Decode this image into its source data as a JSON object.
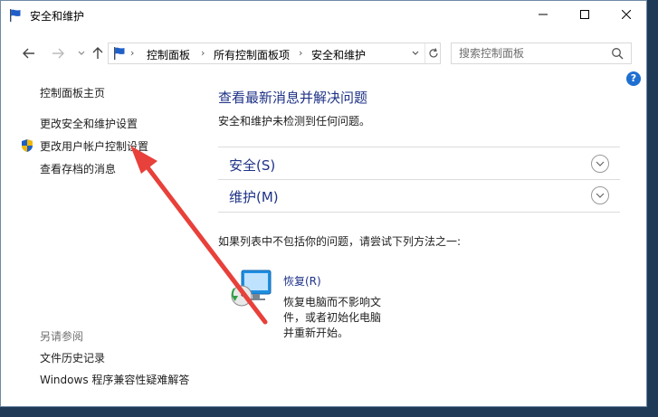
{
  "window": {
    "title": "安全和维护"
  },
  "address": {
    "breadcrumbs": [
      "控制面板",
      "所有控制面板项",
      "安全和维护"
    ]
  },
  "search": {
    "placeholder": "搜索控制面板"
  },
  "help": {
    "label": "?"
  },
  "sidebar": {
    "items": [
      {
        "label": "控制面板主页"
      },
      {
        "label": "更改安全和维护设置"
      },
      {
        "label": "更改用户帐户控制设置"
      },
      {
        "label": "查看存档的消息"
      }
    ],
    "see_also_title": "另请参阅",
    "see_also": [
      {
        "label": "文件历史记录"
      },
      {
        "label": "Windows 程序兼容性疑难解答"
      }
    ]
  },
  "main": {
    "title": "查看最新消息并解决问题",
    "subtitle": "安全和维护未检测到任何问题。",
    "sections": [
      {
        "label": "安全(S)"
      },
      {
        "label": "维护(M)"
      }
    ],
    "intro": "如果列表中不包括你的问题，请尝试下列方法之一:",
    "recovery": {
      "link": "恢复(R)",
      "desc": [
        "恢复电脑而不影响文",
        "件，或者初始化电脑",
        "并重新开始。"
      ]
    }
  },
  "colors": {
    "link": "#1e3287",
    "annotation_arrow": "#e8403a",
    "help_badge": "#1f6fd1"
  },
  "icons": [
    "flag-icon",
    "minimize-icon",
    "maximize-icon",
    "close-icon",
    "back-arrow-icon",
    "forward-arrow-icon",
    "recent-chevron-icon",
    "up-arrow-icon",
    "refresh-icon",
    "search-icon",
    "help-icon",
    "uac-shield-icon",
    "expand-chevron-icon",
    "recovery-icon"
  ]
}
